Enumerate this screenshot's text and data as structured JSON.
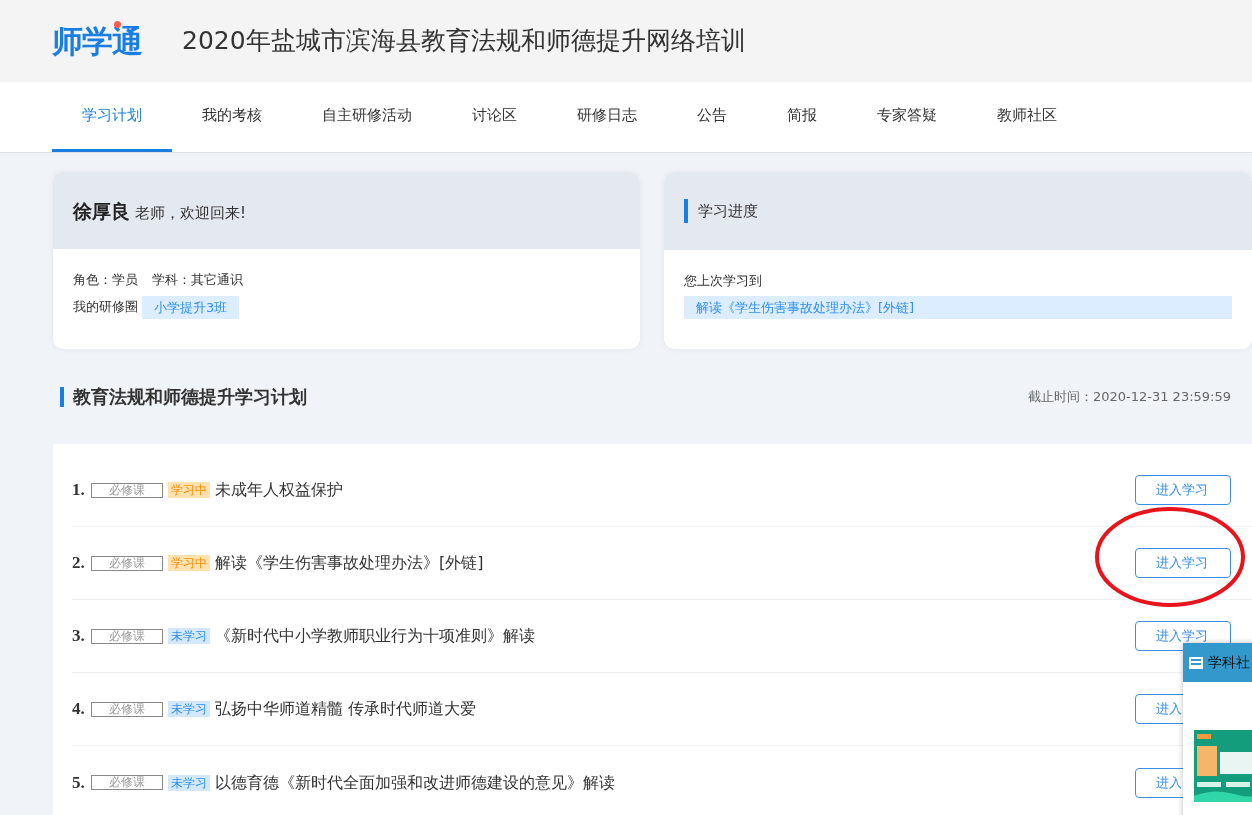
{
  "header": {
    "logo": "师学通",
    "title": "2020年盐城市滨海县教育法规和师德提升网络培训"
  },
  "nav": [
    {
      "label": "学习计划",
      "selected": true
    },
    {
      "label": "我的考核",
      "selected": false
    },
    {
      "label": "自主研修活动",
      "selected": false
    },
    {
      "label": "讨论区",
      "selected": false
    },
    {
      "label": "研修日志",
      "selected": false
    },
    {
      "label": "公告",
      "selected": false
    },
    {
      "label": "简报",
      "selected": false
    },
    {
      "label": "专家答疑",
      "selected": false
    },
    {
      "label": "教师社区",
      "selected": false
    }
  ],
  "welcome_card": {
    "name": "徐厚良",
    "greeting": "老师，欢迎回来!",
    "role": "角色：学员",
    "subject": "学科：其它通识",
    "circle_label": "我的研修圈",
    "circle": "小学提升3班"
  },
  "progress_card": {
    "title": "学习进度",
    "last_label": "您上次学习到",
    "last_link": "解读《学生伤害事故处理办法》[外链]"
  },
  "plan": {
    "title": "教育法规和师德提升学习计划",
    "deadline": "截止时间：2020-12-31 23:59:59",
    "rows": [
      {
        "number": "1.",
        "type_tag": "必修课",
        "status": "学习中",
        "kind": "learning",
        "title": "未成年人权益保护",
        "button": "进入学习",
        "highlighted": false
      },
      {
        "number": "2.",
        "type_tag": "必修课",
        "status": "学习中",
        "kind": "learning",
        "title": "解读《学生伤害事故处理办法》[外链]",
        "button": "进入学习",
        "highlighted": true
      },
      {
        "number": "3.",
        "type_tag": "必修课",
        "status": "未学习",
        "kind": "not_started",
        "title": "《新时代中小学教师职业行为十项准则》解读",
        "button": "进入学习",
        "highlighted": false
      },
      {
        "number": "4.",
        "type_tag": "必修课",
        "status": "未学习",
        "kind": "not_started",
        "title": "弘扬中华师道精髓 传承时代师道大爱",
        "button": "进入",
        "highlighted": false
      },
      {
        "number": "5.",
        "type_tag": "必修课",
        "status": "未学习",
        "kind": "not_started",
        "title": "以德育德《新时代全面加强和改进师德建设的意见》解读",
        "button": "进入",
        "highlighted": false
      }
    ]
  },
  "popup": {
    "title": "学科社"
  }
}
